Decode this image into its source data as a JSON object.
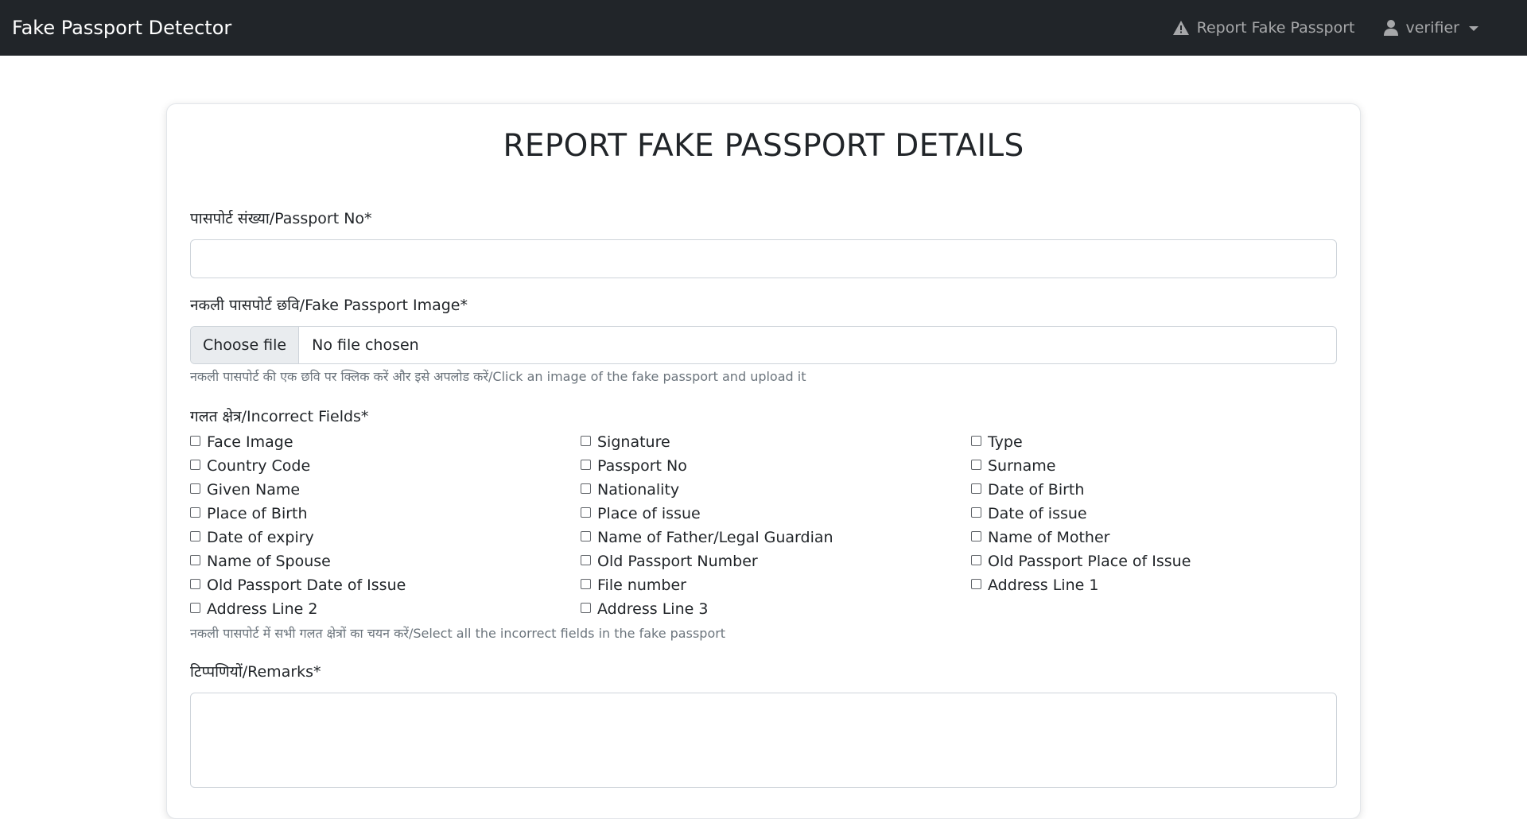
{
  "navbar": {
    "brand": "Fake Passport Detector",
    "report_link": "Report Fake Passport",
    "user_menu": "verifier"
  },
  "form": {
    "title": "REPORT FAKE PASSPORT DETAILS",
    "passport_no_label": "पासपोर्ट संख्या/Passport No*",
    "passport_no_value": "",
    "image_label": "नकली पासपोर्ट छवि/Fake Passport Image*",
    "file_button": "Choose file",
    "file_status": "No file chosen",
    "image_help": "नकली पासपोर्ट की एक छवि पर क्लिक करें और इसे अपलोड करें/Click an image of the fake passport and upload it",
    "fields_label": "गलत क्षेत्र/Incorrect Fields*",
    "fields": [
      "Face Image",
      "Signature",
      "Type",
      "Country Code",
      "Passport No",
      "Surname",
      "Given Name",
      "Nationality",
      "Date of Birth",
      "Place of Birth",
      "Place of issue",
      "Date of issue",
      "Date of expiry",
      "Name of Father/Legal Guardian",
      "Name of Mother",
      "Name of Spouse",
      "Old Passport Number",
      "Old Passport Place of Issue",
      "Old Passport Date of Issue",
      "File number",
      "Address Line 1",
      "Address Line 2",
      "Address Line 3"
    ],
    "fields_help": "नकली पासपोर्ट में सभी गलत क्षेत्रों का चयन करें/Select all the incorrect fields in the fake passport",
    "remarks_label": "टिप्पणियों/Remarks*",
    "remarks_value": ""
  },
  "icons": {
    "warning": "warning-icon",
    "user": "user-icon",
    "caret": "caret-down-icon"
  }
}
